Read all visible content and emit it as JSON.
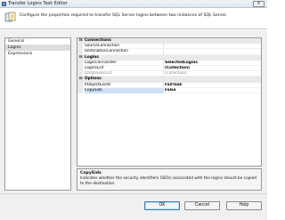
{
  "window": {
    "title": "Transfer Logins Task Editor",
    "close_label": "X"
  },
  "header": {
    "description": "Configure the properties required to transfer SQL Server logins between two instances of SQL Server."
  },
  "nav": {
    "items": [
      {
        "label": "General",
        "selected": false
      },
      {
        "label": "Logins",
        "selected": true
      },
      {
        "label": "Expressions",
        "selected": false
      }
    ]
  },
  "grid": {
    "categories": [
      {
        "label": "Connections",
        "toggle": "⊟",
        "properties": [
          {
            "name": "SourceConnection",
            "value": ""
          },
          {
            "name": "DestinationConnection",
            "value": ""
          }
        ]
      },
      {
        "label": "Logins",
        "toggle": "⊟",
        "properties": [
          {
            "name": "LoginsToTransfer",
            "value": "SelectedLogins"
          },
          {
            "name": "LoginsList",
            "value": "(Collection)"
          },
          {
            "name": "DatabasesList",
            "value": "(Collection)"
          }
        ]
      },
      {
        "label": "Options",
        "toggle": "⊟",
        "properties": [
          {
            "name": "IfObjectExists",
            "value": "FailTask"
          },
          {
            "name": "CopySids",
            "value": "False"
          }
        ]
      }
    ]
  },
  "description_panel": {
    "title": "CopySids",
    "text": "Indicates whether the security identifiers (SIDs) associated with the logins should be copied to the destination."
  },
  "buttons": {
    "ok": "OK",
    "cancel": "Cancel",
    "help": "Help"
  }
}
